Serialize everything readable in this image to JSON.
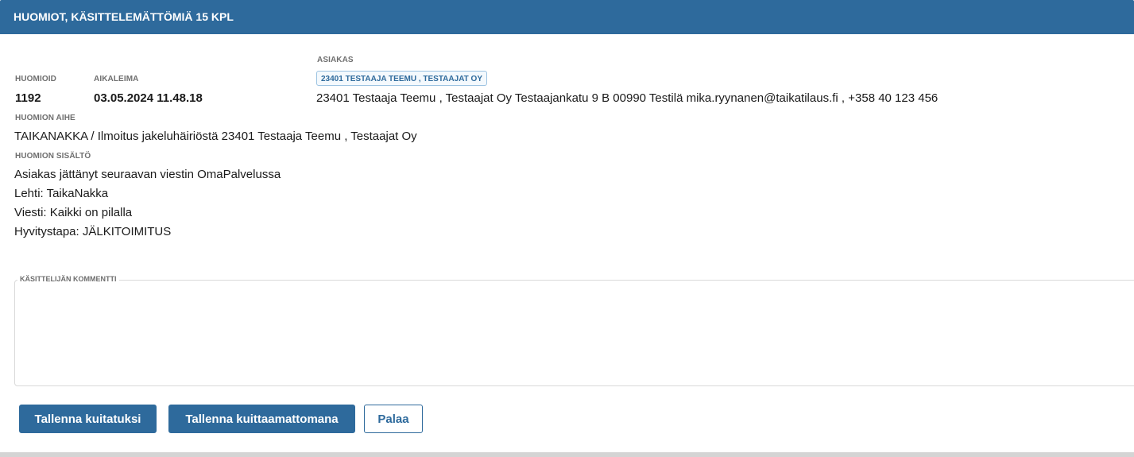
{
  "header": {
    "title": "HUOMIOT, KÄSITTELEMÄTTÖMIÄ 15 KPL"
  },
  "fields": {
    "id_label": "HUOMIOID",
    "id_value": "1192",
    "timestamp_label": "AIKALEIMA",
    "timestamp_value": "03.05.2024 11.48.18",
    "customer_label": "ASIAKAS",
    "customer_badge": "23401 TESTAAJA TEEMU , TESTAAJAT OY",
    "customer_details": "23401 Testaaja Teemu , Testaajat Oy Testaajankatu 9 B 00990 Testilä mika.ryynanen@taikatilaus.fi , +358 40 123 456",
    "subject_label": "HUOMION AIHE",
    "subject_value": "TAIKANAKKA / Ilmoitus jakeluhäiriöstä 23401 Testaaja Teemu , Testaajat Oy",
    "content_label": "HUOMION SISÄLTÖ",
    "content_lines": [
      "Asiakas jättänyt seuraavan viestin OmaPalvelussa",
      "Lehti: TaikaNakka",
      "Viesti: Kaikki on pilalla",
      "Hyvitystapa: JÄLKITOIMITUS"
    ]
  },
  "comment": {
    "label": "KÄSITTELIJÄN KOMMENTTI",
    "value": "",
    "placeholder": ""
  },
  "actions": {
    "save_acknowledged": "Tallenna kuitatuksi",
    "save_unacknowledged": "Tallenna kuittaamattomana",
    "back": "Palaa"
  },
  "colors": {
    "primary": "#2e6a9c",
    "badge_border": "#9cc3e2"
  }
}
